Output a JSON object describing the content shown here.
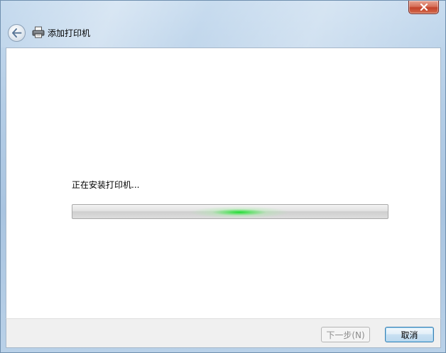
{
  "window": {
    "title": "添加打印机",
    "close_icon": "close-icon",
    "back_icon": "back-arrow-icon",
    "app_icon": "printer-icon"
  },
  "content": {
    "status_text": "正在安装打印机...",
    "progress_style": "indeterminate-marquee",
    "progress_color": "#22dd33"
  },
  "footer": {
    "next_label": "下一步(N)",
    "next_enabled": false,
    "cancel_label": "取消"
  }
}
